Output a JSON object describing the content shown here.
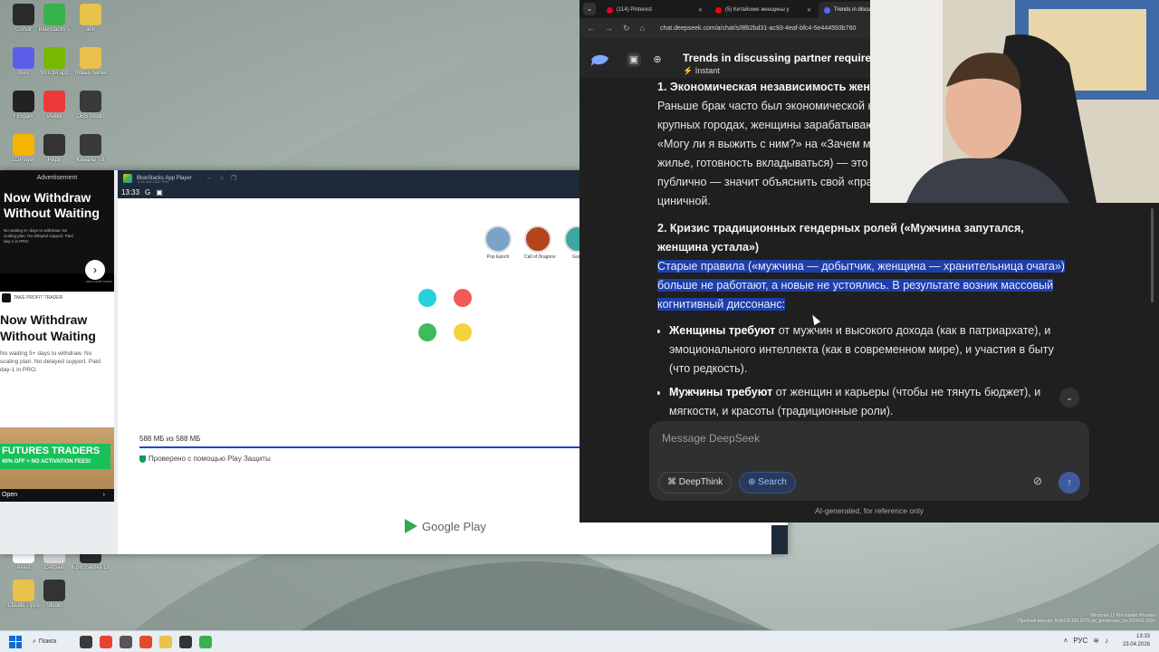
{
  "desktop": {
    "icons": [
      {
        "label": "Cursor",
        "color": "#2b2b2b"
      },
      {
        "label": "BlueStacks 5",
        "color": "#38b24a"
      },
      {
        "label": "апп",
        "color": "#e8c24a"
      },
      {
        "label": "Klex",
        "color": "#5b5fe8"
      },
      {
        "label": "NVIDIA app",
        "color": "#76b900"
      },
      {
        "label": "Новая папка",
        "color": "#e8c24a"
      },
      {
        "label": "FxSpark",
        "color": "#222222"
      },
      {
        "label": "Vivaldi",
        "color": "#ef3939"
      },
      {
        "label": "OBS Studio",
        "color": "#3a3a3a"
      },
      {
        "label": "LDPlayer",
        "color": "#f5b400"
      },
      {
        "label": "Happ",
        "color": "#333333"
      },
      {
        "label": "Каналы ТВ",
        "color": "#3a3a3a"
      },
      {
        "label": "Avast",
        "color": "#ffffff"
      },
      {
        "label": "Сыграю",
        "color": "#d6d6d6"
      },
      {
        "label": "Epic Games Launcher",
        "color": "#2a2a2a"
      },
      {
        "label": "Claude Tipps",
        "color": "#e8c24a"
      },
      {
        "label": "Studio",
        "color": "#333333"
      }
    ]
  },
  "bluestacks": {
    "title": "BlueStacks App Player",
    "version": "5.22.100.1037 P64",
    "status_time": "13:33",
    "status_g": "G",
    "apps": [
      {
        "label": "Pop Epoch",
        "color": "#7aa3c8"
      },
      {
        "label": "Call of Dragons",
        "color": "#b5431c"
      },
      {
        "label": "Gunz",
        "color": "#3fa5a0"
      }
    ],
    "loader_colors": [
      "#26d0dc",
      "#f05a57",
      "#3cbc5a",
      "#f3d33b"
    ],
    "progress_text": "588 МБ из 588 МБ",
    "progress_value": 1.0,
    "verified_text": "Проверено с помощью Play Защиты",
    "gplay_label": "Google Play"
  },
  "ad": {
    "header": "Advertisement",
    "top_title": "Now Withdraw Without Waiting",
    "top_body": "No waiting 5+ days to withdraw. No scaling plan. No delayed support. Paid day-1 in PRO.",
    "arrow": "›",
    "url": "take profit trader",
    "brand": "TAKE PROFIT TRADER",
    "mid_title": "Now Withdraw Without Waiting",
    "mid_body": "No waiting 5+ days to withdraw. No scaling plan. No delayed support. Paid day-1 in PRO.",
    "bottom_title": "FUTURES TRADERS",
    "bottom_sub": "40% OFF + NO ACTIVATION FEES!",
    "open_label": "Open",
    "open_chev": "›"
  },
  "browser": {
    "tabs": [
      {
        "label": "(114) Pinterest",
        "color": "#e60023"
      },
      {
        "label": "(5) Китайские женщины у",
        "color": "#ff0000"
      },
      {
        "label": "Trends in discuss",
        "color": "#4d6bfe"
      }
    ],
    "tab_close": "✕",
    "tab_menu": "⌄",
    "nav": {
      "back": "←",
      "forward": "→",
      "reload": "↻",
      "home": "⌂",
      "site_info": "⚙"
    },
    "url": "chat.deepseek.com/a/chat/s/8f82bd31-ac93-4eaf-bfc4-5e444593b760",
    "header": {
      "title": "Trends in discussing partner requirements",
      "mode": "⚡ Instant",
      "sidebar_icon": "▣",
      "new_chat_icon": "⊕"
    },
    "chat": {
      "heading1": "1. Экономическая независимость женщин",
      "p1": "Раньше брак часто был экономической необходимостью. Сейчас, особенно в крупных городах, женщины зарабатывают сами, и эта формула сменилась с «Могу ли я выжить с ним?» на «Зачем мне он?». Требования (зарплата, жилье, готовность вкладываться) — это защита своего ресурса. Обсуждать их публично — значит объяснить свой «прагматизм», чтобы не казаться циничной.",
      "heading2": "2. Кризис традиционных гендерных ролей («Мужчина запутался, женщина устала»)",
      "p2_highlight": "Старые правила («мужчина — добытчик, женщина — хранительница очага») больше не работают, а новые не устоялись. В результате возник массовый когнитивный диссонанс:",
      "bullets": [
        {
          "bold": "Женщины требуют",
          "text": " от мужчин и высокого дохода (как в патриархате), и эмоционального интеллекта (как в современном мире), и участия в быту (что редкость)."
        },
        {
          "bold": "Мужчины требуют",
          "text": " от женщин и карьеры (чтобы не тянуть бюджет), и мягкости, и красоты (традиционные роли)."
        }
      ]
    },
    "scroll_down": "⌄",
    "input": {
      "placeholder": "Message DeepSeek",
      "deepthink": "DeepThink",
      "search": "Search",
      "clip": "⊘",
      "send": "↑"
    },
    "ai_note": "AI-generated, for reference only"
  },
  "taskbar": {
    "search": "Поиск",
    "lang": "РУС",
    "time": "13:33",
    "date": "23.04.2026",
    "apps": [
      "#3a3a3a",
      "#ea4335",
      "#555555",
      "#e24a2b",
      "#e8c24a",
      "#333333",
      "#38b24a"
    ]
  },
  "watermark": {
    "line1": "Windows 11 Pro Insider Preview",
    "line2": "Пробная версия. Build 26100.0276.ge_prerelease_im.260410-1655"
  }
}
